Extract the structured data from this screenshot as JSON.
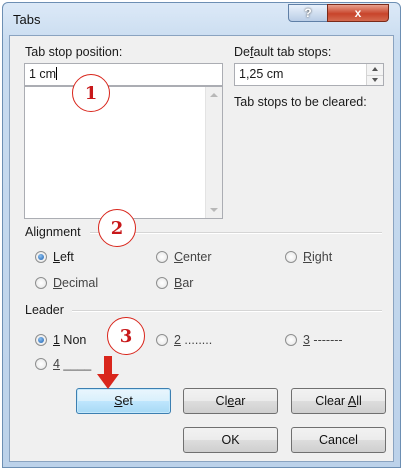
{
  "window": {
    "title": "Tabs",
    "help_glyph": "?",
    "close_glyph": "x"
  },
  "tab_stop_position": {
    "label_pre": "Tab stop ",
    "label_hidden": "po",
    "label_post": "sition:",
    "value": "1 cm"
  },
  "default_tab_stops": {
    "label_pre": "De",
    "label_u": "f",
    "label_post": "ault tab stops:",
    "value": "1,25 cm"
  },
  "cleared": {
    "label": "Tab stops to be cleared:"
  },
  "alignment": {
    "label": "Alignment",
    "options": [
      {
        "u": "L",
        "rest": "eft",
        "selected": true
      },
      {
        "u": "C",
        "rest": "enter",
        "selected": false
      },
      {
        "u": "R",
        "rest": "ight",
        "selected": false
      },
      {
        "u": "D",
        "rest": "ecimal",
        "selected": false
      },
      {
        "u": "B",
        "rest": "ar",
        "selected": false
      }
    ]
  },
  "leader": {
    "label": "Leader",
    "options": [
      {
        "u": "1",
        "rest": " Non",
        "selected": true
      },
      {
        "u": "2",
        "rest": " ........",
        "selected": false
      },
      {
        "u": "3",
        "rest": " -------",
        "selected": false
      },
      {
        "u": "4",
        "rest": " ____",
        "selected": false
      }
    ]
  },
  "buttons": {
    "set": {
      "u": "S",
      "rest": "et"
    },
    "clear": {
      "pre": "Cl",
      "u": "e",
      "rest": "ar"
    },
    "clear_all": {
      "pre": "Clear ",
      "u": "A",
      "rest": "ll"
    },
    "ok": "OK",
    "cancel": "Cancel"
  },
  "callouts": [
    "1",
    "2",
    "3"
  ],
  "colors": {
    "callout_red": "#d9261c",
    "accent_blue": "#3c7fb1"
  }
}
